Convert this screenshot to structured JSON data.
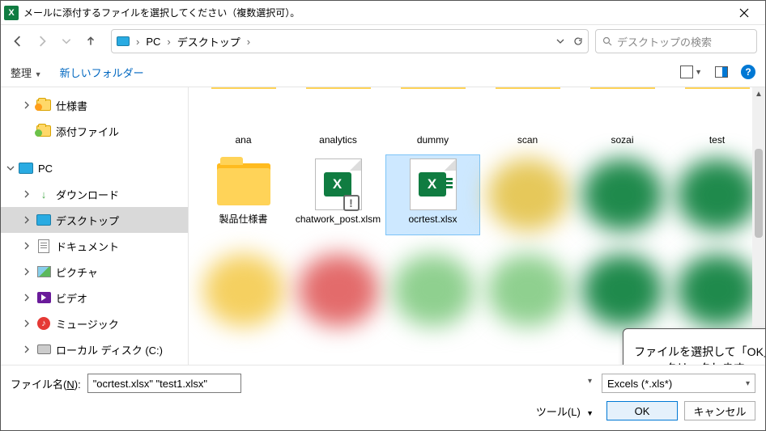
{
  "title": "メールに添付するファイルを選択してください（複数選択可）。",
  "breadcrumb": {
    "root": "PC",
    "current": "デスクトップ"
  },
  "search_placeholder": "デスクトップの検索",
  "toolbar": {
    "organize": "整理",
    "newfolder": "新しいフォルダー"
  },
  "tree": {
    "quick1": "仕様書",
    "quick2": "添付ファイル",
    "pc": "PC",
    "downloads": "ダウンロード",
    "desktop": "デスクトップ",
    "documents": "ドキュメント",
    "pictures": "ピクチャ",
    "videos": "ビデオ",
    "music": "ミュージック",
    "disk": "ローカル ディスク (C:)"
  },
  "folders_row1": [
    "ana",
    "analytics",
    "dummy",
    "scan",
    "sozai",
    "test"
  ],
  "items_row2": {
    "folder1": "製品仕様書",
    "file1": "chatwork_post.xlsm",
    "file2": "ocrtest.xlsx"
  },
  "callout": "ファイルを選択して「OK」をクリックします。",
  "footer": {
    "filename_label_pre": "ファイル名(",
    "filename_label_u": "N",
    "filename_label_post": "):",
    "filename_value": "\"ocrtest.xlsx\" \"test1.xlsx\"",
    "filter": "Excels (*.xls*)",
    "tools_pre": "ツール(",
    "tools_u": "L",
    "tools_post": ")",
    "ok": "OK",
    "cancel": "キャンセル"
  }
}
